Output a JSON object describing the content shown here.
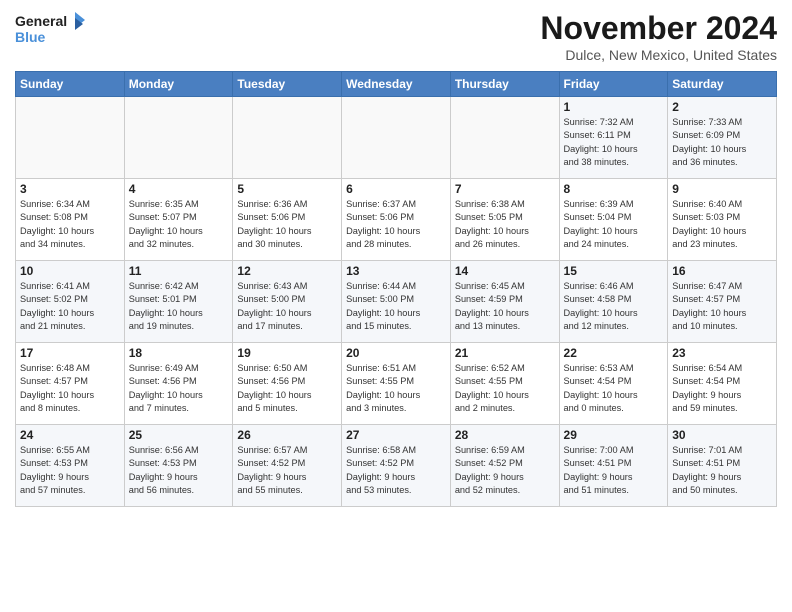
{
  "logo": {
    "line1": "General",
    "line2": "Blue"
  },
  "title": "November 2024",
  "location": "Dulce, New Mexico, United States",
  "days_of_week": [
    "Sunday",
    "Monday",
    "Tuesday",
    "Wednesday",
    "Thursday",
    "Friday",
    "Saturday"
  ],
  "weeks": [
    [
      {
        "day": "",
        "info": ""
      },
      {
        "day": "",
        "info": ""
      },
      {
        "day": "",
        "info": ""
      },
      {
        "day": "",
        "info": ""
      },
      {
        "day": "",
        "info": ""
      },
      {
        "day": "1",
        "info": "Sunrise: 7:32 AM\nSunset: 6:11 PM\nDaylight: 10 hours\nand 38 minutes."
      },
      {
        "day": "2",
        "info": "Sunrise: 7:33 AM\nSunset: 6:09 PM\nDaylight: 10 hours\nand 36 minutes."
      }
    ],
    [
      {
        "day": "3",
        "info": "Sunrise: 6:34 AM\nSunset: 5:08 PM\nDaylight: 10 hours\nand 34 minutes."
      },
      {
        "day": "4",
        "info": "Sunrise: 6:35 AM\nSunset: 5:07 PM\nDaylight: 10 hours\nand 32 minutes."
      },
      {
        "day": "5",
        "info": "Sunrise: 6:36 AM\nSunset: 5:06 PM\nDaylight: 10 hours\nand 30 minutes."
      },
      {
        "day": "6",
        "info": "Sunrise: 6:37 AM\nSunset: 5:06 PM\nDaylight: 10 hours\nand 28 minutes."
      },
      {
        "day": "7",
        "info": "Sunrise: 6:38 AM\nSunset: 5:05 PM\nDaylight: 10 hours\nand 26 minutes."
      },
      {
        "day": "8",
        "info": "Sunrise: 6:39 AM\nSunset: 5:04 PM\nDaylight: 10 hours\nand 24 minutes."
      },
      {
        "day": "9",
        "info": "Sunrise: 6:40 AM\nSunset: 5:03 PM\nDaylight: 10 hours\nand 23 minutes."
      }
    ],
    [
      {
        "day": "10",
        "info": "Sunrise: 6:41 AM\nSunset: 5:02 PM\nDaylight: 10 hours\nand 21 minutes."
      },
      {
        "day": "11",
        "info": "Sunrise: 6:42 AM\nSunset: 5:01 PM\nDaylight: 10 hours\nand 19 minutes."
      },
      {
        "day": "12",
        "info": "Sunrise: 6:43 AM\nSunset: 5:00 PM\nDaylight: 10 hours\nand 17 minutes."
      },
      {
        "day": "13",
        "info": "Sunrise: 6:44 AM\nSunset: 5:00 PM\nDaylight: 10 hours\nand 15 minutes."
      },
      {
        "day": "14",
        "info": "Sunrise: 6:45 AM\nSunset: 4:59 PM\nDaylight: 10 hours\nand 13 minutes."
      },
      {
        "day": "15",
        "info": "Sunrise: 6:46 AM\nSunset: 4:58 PM\nDaylight: 10 hours\nand 12 minutes."
      },
      {
        "day": "16",
        "info": "Sunrise: 6:47 AM\nSunset: 4:57 PM\nDaylight: 10 hours\nand 10 minutes."
      }
    ],
    [
      {
        "day": "17",
        "info": "Sunrise: 6:48 AM\nSunset: 4:57 PM\nDaylight: 10 hours\nand 8 minutes."
      },
      {
        "day": "18",
        "info": "Sunrise: 6:49 AM\nSunset: 4:56 PM\nDaylight: 10 hours\nand 7 minutes."
      },
      {
        "day": "19",
        "info": "Sunrise: 6:50 AM\nSunset: 4:56 PM\nDaylight: 10 hours\nand 5 minutes."
      },
      {
        "day": "20",
        "info": "Sunrise: 6:51 AM\nSunset: 4:55 PM\nDaylight: 10 hours\nand 3 minutes."
      },
      {
        "day": "21",
        "info": "Sunrise: 6:52 AM\nSunset: 4:55 PM\nDaylight: 10 hours\nand 2 minutes."
      },
      {
        "day": "22",
        "info": "Sunrise: 6:53 AM\nSunset: 4:54 PM\nDaylight: 10 hours\nand 0 minutes."
      },
      {
        "day": "23",
        "info": "Sunrise: 6:54 AM\nSunset: 4:54 PM\nDaylight: 9 hours\nand 59 minutes."
      }
    ],
    [
      {
        "day": "24",
        "info": "Sunrise: 6:55 AM\nSunset: 4:53 PM\nDaylight: 9 hours\nand 57 minutes."
      },
      {
        "day": "25",
        "info": "Sunrise: 6:56 AM\nSunset: 4:53 PM\nDaylight: 9 hours\nand 56 minutes."
      },
      {
        "day": "26",
        "info": "Sunrise: 6:57 AM\nSunset: 4:52 PM\nDaylight: 9 hours\nand 55 minutes."
      },
      {
        "day": "27",
        "info": "Sunrise: 6:58 AM\nSunset: 4:52 PM\nDaylight: 9 hours\nand 53 minutes."
      },
      {
        "day": "28",
        "info": "Sunrise: 6:59 AM\nSunset: 4:52 PM\nDaylight: 9 hours\nand 52 minutes."
      },
      {
        "day": "29",
        "info": "Sunrise: 7:00 AM\nSunset: 4:51 PM\nDaylight: 9 hours\nand 51 minutes."
      },
      {
        "day": "30",
        "info": "Sunrise: 7:01 AM\nSunset: 4:51 PM\nDaylight: 9 hours\nand 50 minutes."
      }
    ]
  ]
}
